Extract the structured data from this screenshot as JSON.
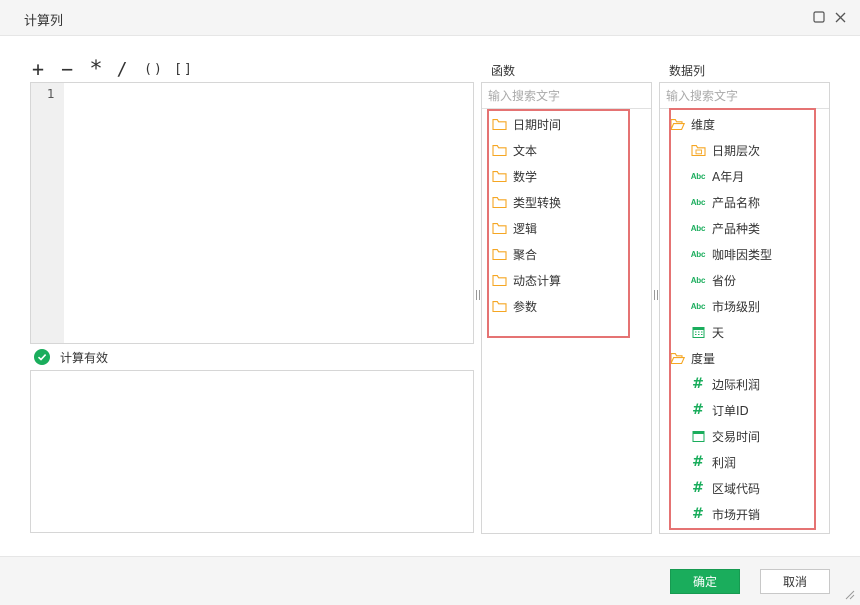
{
  "dialog": {
    "title": "计算列",
    "maximize_icon": "maximize-icon",
    "close_icon": "close-icon"
  },
  "operators": [
    "+",
    "−",
    "*",
    "/",
    "()",
    "[]"
  ],
  "editor": {
    "line_number": "1",
    "content": ""
  },
  "validation": {
    "text": "计算有效",
    "icon": "check-circle-icon",
    "color": "#1aad5c"
  },
  "functions": {
    "label": "函数",
    "search_placeholder": "输入搜索文字",
    "items": [
      {
        "label": "日期时间",
        "icon": "folder-icon"
      },
      {
        "label": "文本",
        "icon": "folder-icon"
      },
      {
        "label": "数学",
        "icon": "folder-icon"
      },
      {
        "label": "类型转换",
        "icon": "folder-icon"
      },
      {
        "label": "逻辑",
        "icon": "folder-icon"
      },
      {
        "label": "聚合",
        "icon": "folder-icon"
      },
      {
        "label": "动态计算",
        "icon": "folder-icon"
      },
      {
        "label": "参数",
        "icon": "folder-icon"
      }
    ]
  },
  "data_columns": {
    "label": "数据列",
    "search_placeholder": "输入搜索文字",
    "groups": [
      {
        "label": "维度",
        "icon": "folder-open-icon",
        "items": [
          {
            "label": "日期层次",
            "icon": "date-hierarchy-icon"
          },
          {
            "label": "A年月",
            "icon": "text-field-icon",
            "type_badge": "Abc"
          },
          {
            "label": "产品名称",
            "icon": "text-field-icon",
            "type_badge": "Abc"
          },
          {
            "label": "产品种类",
            "icon": "text-field-icon",
            "type_badge": "Abc"
          },
          {
            "label": "咖啡因类型",
            "icon": "text-field-icon",
            "type_badge": "Abc"
          },
          {
            "label": "省份",
            "icon": "text-field-icon",
            "type_badge": "Abc"
          },
          {
            "label": "市场级别",
            "icon": "text-field-icon",
            "type_badge": "Abc"
          },
          {
            "label": "天",
            "icon": "calendar-icon"
          }
        ]
      },
      {
        "label": "度量",
        "icon": "folder-open-icon",
        "items": [
          {
            "label": "边际利润",
            "icon": "numeric-field-icon",
            "type_badge": "#"
          },
          {
            "label": "订单ID",
            "icon": "numeric-field-icon",
            "type_badge": "#"
          },
          {
            "label": "交易时间",
            "icon": "datetime-field-icon"
          },
          {
            "label": "利润",
            "icon": "numeric-field-icon",
            "type_badge": "#"
          },
          {
            "label": "区域代码",
            "icon": "numeric-field-icon",
            "type_badge": "#"
          },
          {
            "label": "市场开销",
            "icon": "numeric-field-icon",
            "type_badge": "#"
          }
        ]
      }
    ]
  },
  "footer": {
    "ok_label": "确定",
    "cancel_label": "取消"
  },
  "colors": {
    "accent": "#1aad5c",
    "folder": "#f5a623",
    "highlight_box": "#e57373"
  }
}
